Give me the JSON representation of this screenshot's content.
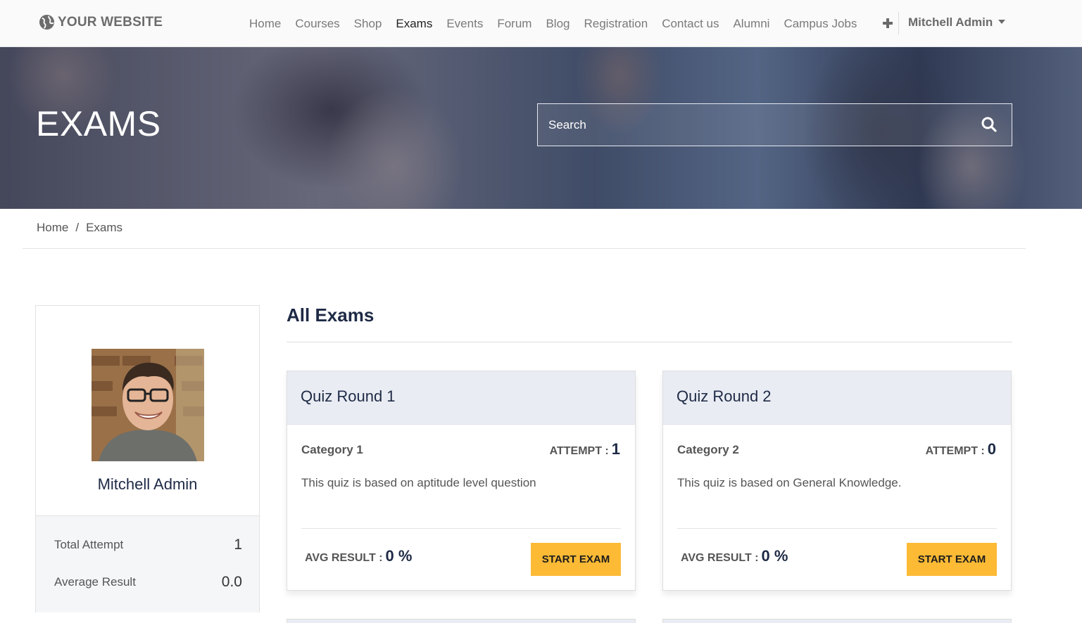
{
  "site": {
    "name": "YOUR WEBSITE"
  },
  "nav": {
    "links": [
      "Home",
      "Courses",
      "Shop",
      "Exams",
      "Events",
      "Forum",
      "Blog",
      "Registration",
      "Contact us",
      "Alumni",
      "Campus Jobs"
    ],
    "active": "Exams",
    "user": "Mitchell Admin"
  },
  "hero": {
    "title": "EXAMS",
    "search_placeholder": "Search"
  },
  "breadcrumb": {
    "home": "Home",
    "separator": "/",
    "current": "Exams"
  },
  "profile": {
    "name": "Mitchell Admin",
    "total_attempt_label": "Total Attempt",
    "total_attempt_value": "1",
    "average_result_label": "Average Result",
    "average_result_value": "0.0"
  },
  "main": {
    "title": "All Exams",
    "exams": [
      {
        "title": "Quiz Round 1",
        "category": "Category 1",
        "attempt_label": "ATTEMPT :",
        "attempt_value": "1",
        "description": "This quiz is based on aptitude level question",
        "avg_label": "AVG RESULT :",
        "avg_value": "0 %",
        "button": "START EXAM"
      },
      {
        "title": "Quiz Round 2",
        "category": "Category 2",
        "attempt_label": "ATTEMPT :",
        "attempt_value": "0",
        "description": "This quiz is based on General Knowledge.",
        "avg_label": "AVG RESULT :",
        "avg_value": "0 %",
        "button": "START EXAM"
      }
    ]
  },
  "icons": {
    "logo": "globe-icon",
    "add": "plus-icon",
    "user_menu": "caret-down-icon",
    "search": "search-icon"
  },
  "colors": {
    "accent": "#fcba35",
    "heading": "#1e2a45",
    "card_header": "#e9ecf3",
    "hero_overlay": "#263860"
  }
}
